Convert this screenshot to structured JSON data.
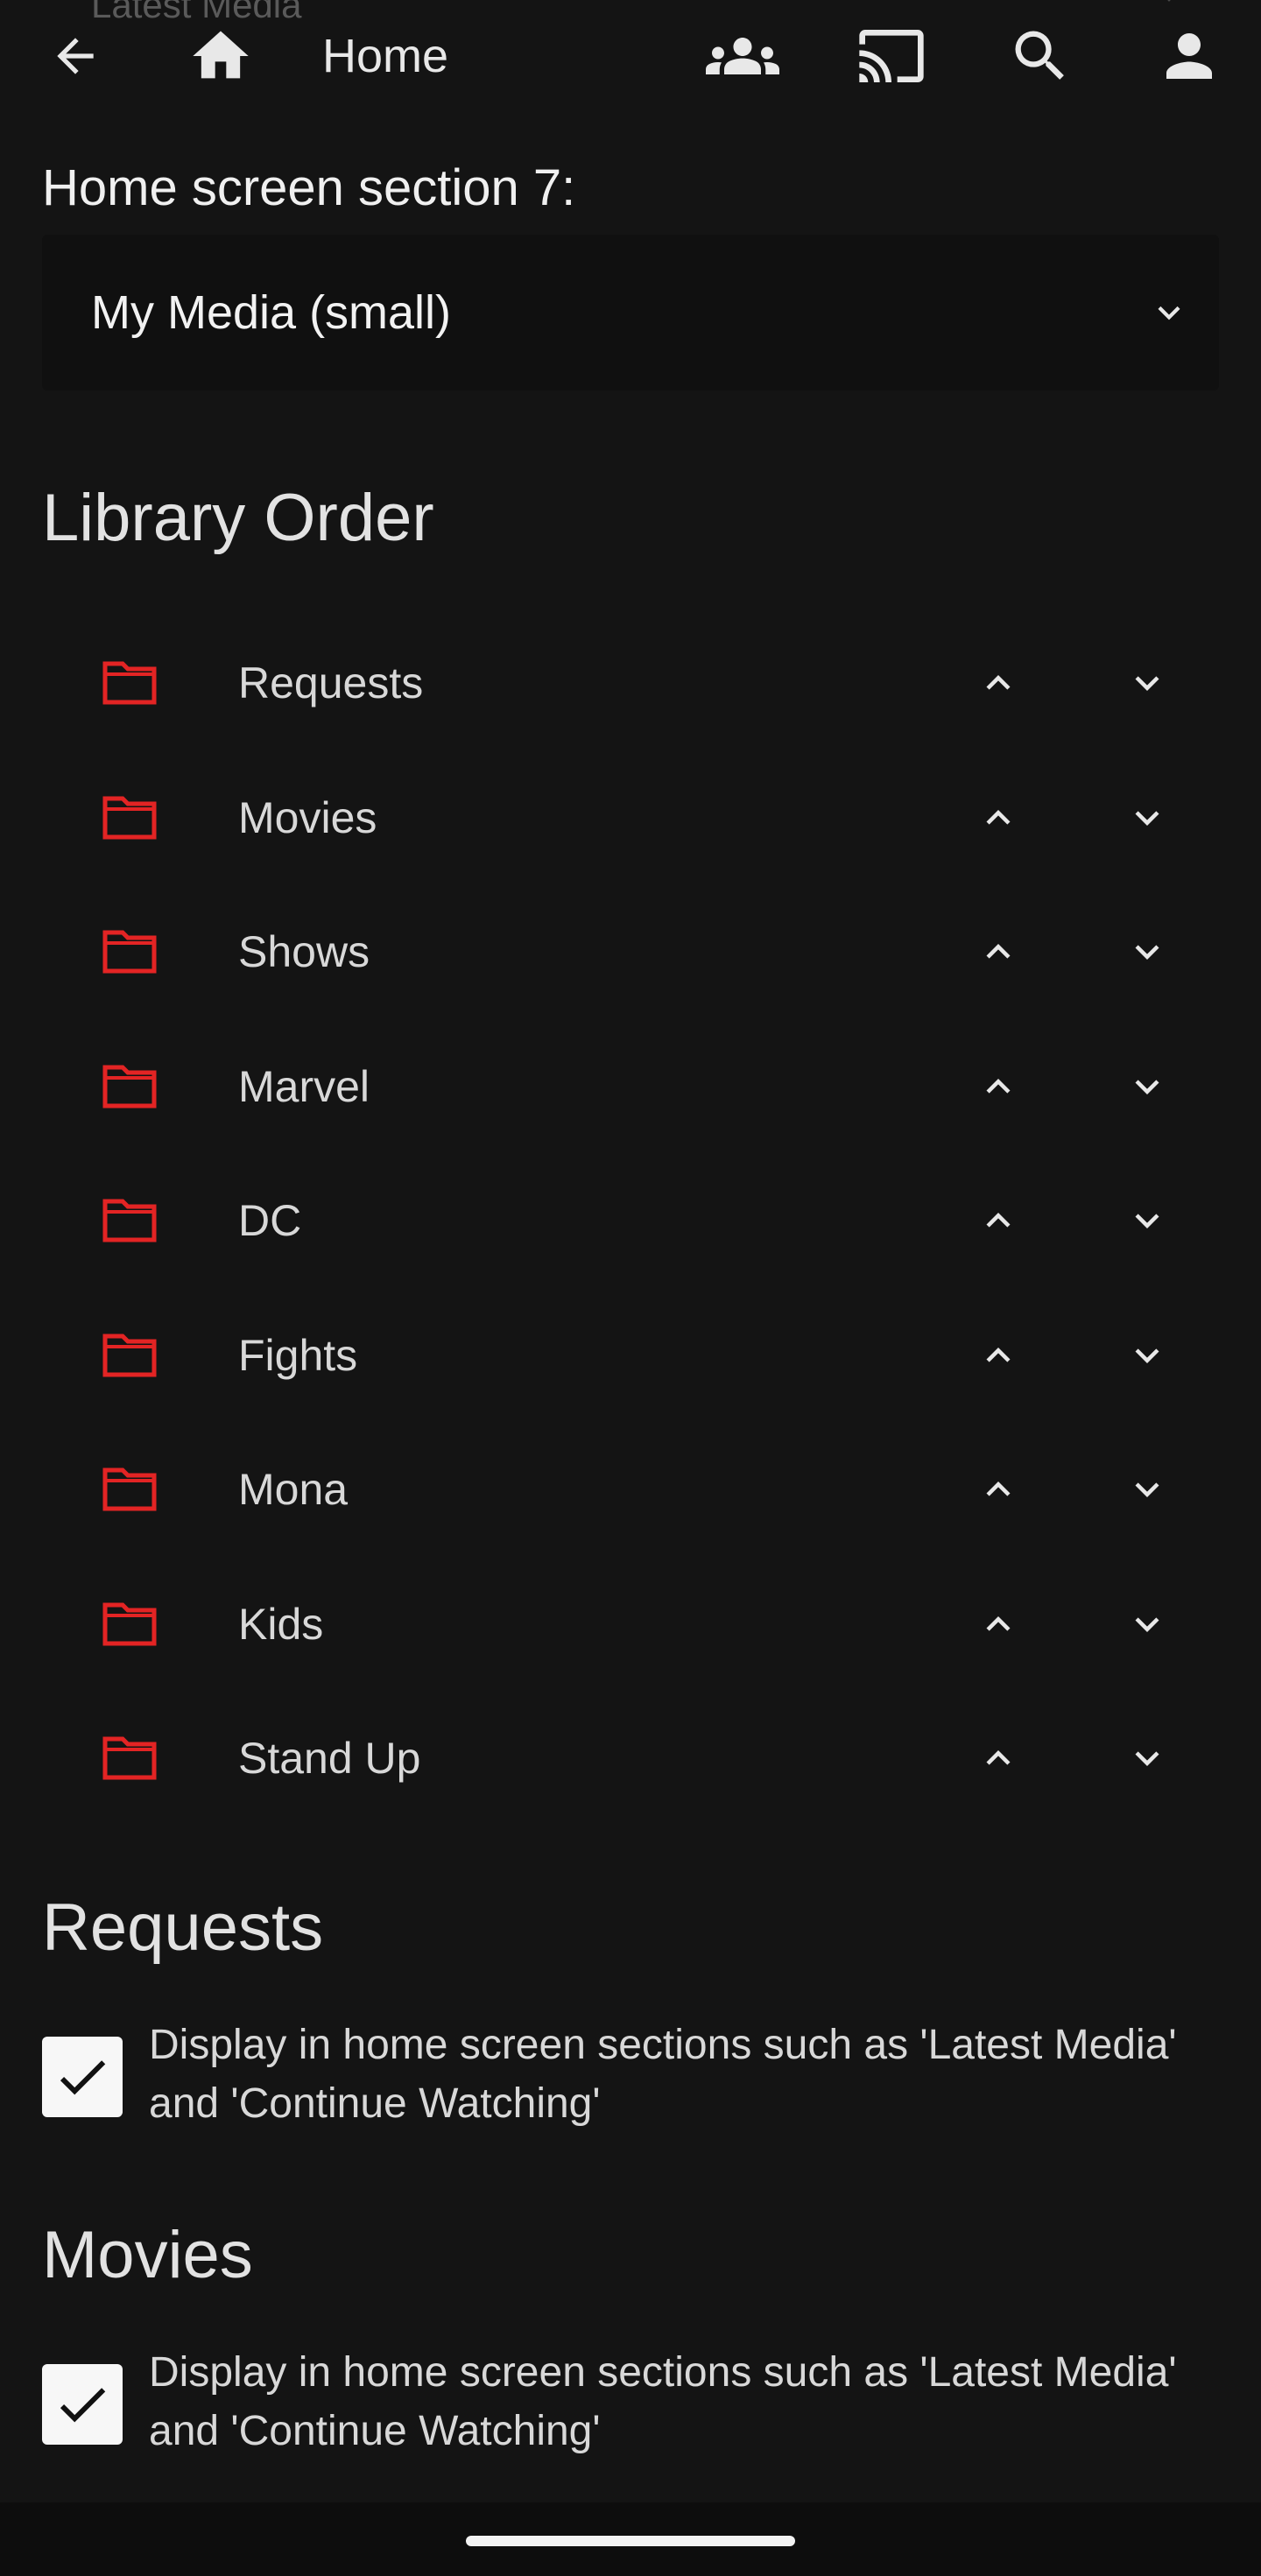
{
  "header": {
    "peek_text": "Latest Media",
    "title": "Home",
    "icons": {
      "back": "arrow-back-icon",
      "home": "home-icon",
      "users": "users-icon",
      "cast": "cast-icon",
      "search": "search-icon",
      "user": "user-icon"
    }
  },
  "section_select": {
    "label": "Home screen section 7:",
    "value": "My Media (small)"
  },
  "library_order": {
    "title": "Library Order",
    "items": [
      {
        "name": "Requests"
      },
      {
        "name": "Movies"
      },
      {
        "name": "Shows"
      },
      {
        "name": "Marvel"
      },
      {
        "name": "DC"
      },
      {
        "name": "Fights"
      },
      {
        "name": "Mona"
      },
      {
        "name": "Kids"
      },
      {
        "name": "Stand Up"
      }
    ]
  },
  "library_sections": [
    {
      "title": "Requests",
      "checkbox_label": "Display in home screen sections such as 'Latest Media' and 'Continue Watching'",
      "checked": true
    },
    {
      "title": "Movies",
      "checkbox_label": "Display in home screen sections such as 'Latest Media' and 'Continue Watching'",
      "checked": true
    }
  ],
  "colors": {
    "background": "#141414",
    "accent": "#e50914",
    "text": "#e6e6e6"
  }
}
